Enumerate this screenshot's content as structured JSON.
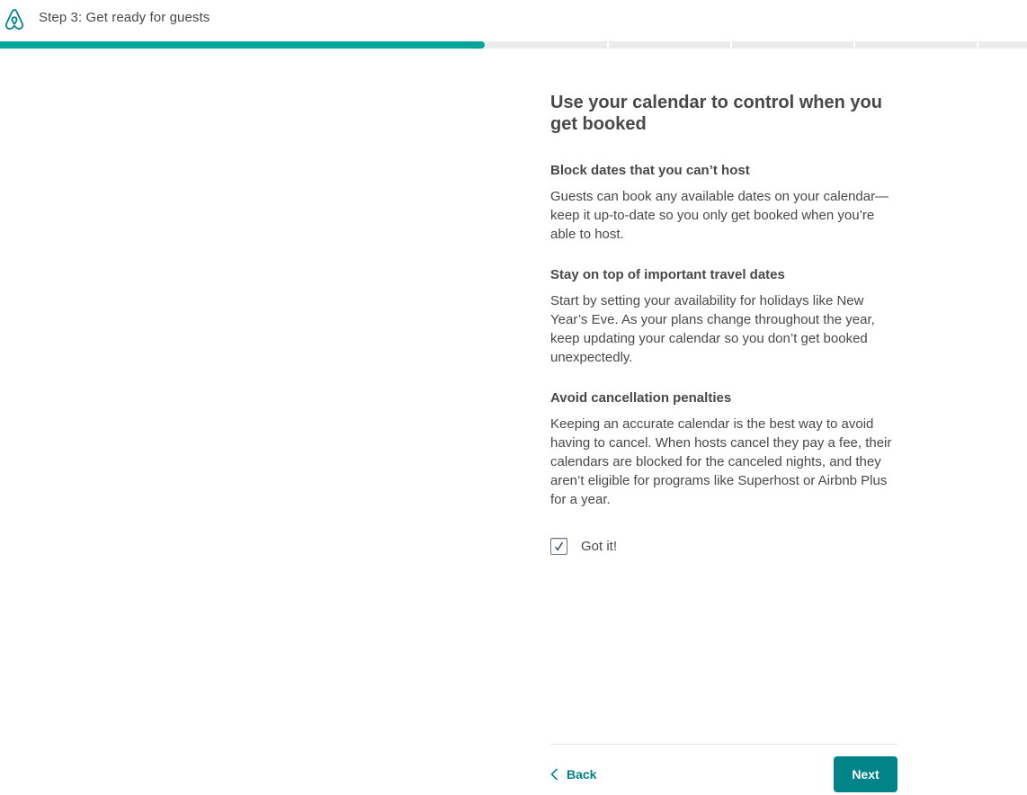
{
  "header": {
    "step_title": "Step 3: Get ready for guests",
    "logo_icon": "airbnb-logo-icon",
    "brand_color": "#008489"
  },
  "progress": {
    "fraction": 0.472,
    "segments": 8,
    "fill_color": "#00a699",
    "track_color": "#ebebeb"
  },
  "main": {
    "heading": "Use your calendar to control when you get booked",
    "sections": [
      {
        "title": "Block dates that you can’t host",
        "body": "Guests can book any available dates on your calendar—keep it up-to-date so you only get booked when you’re able to host."
      },
      {
        "title": "Stay on top of important travel dates",
        "body": "Start by setting your availability for holidays like New Year’s Eve. As your plans change throughout the year, keep updating your calendar so you don’t get booked unexpectedly."
      },
      {
        "title": "Avoid cancellation penalties",
        "body": "Keeping an accurate calendar is the best way to avoid having to cancel. When hosts cancel they pay a fee, their calendars are blocked for the canceled nights, and they aren’t eligible for programs like Superhost or Airbnb Plus for a year."
      }
    ],
    "acknowledge": {
      "label": "Got it!",
      "checked": true,
      "icon": "checkmark-icon"
    }
  },
  "footer": {
    "back_label": "Back",
    "back_icon": "chevron-left-icon",
    "next_label": "Next"
  }
}
